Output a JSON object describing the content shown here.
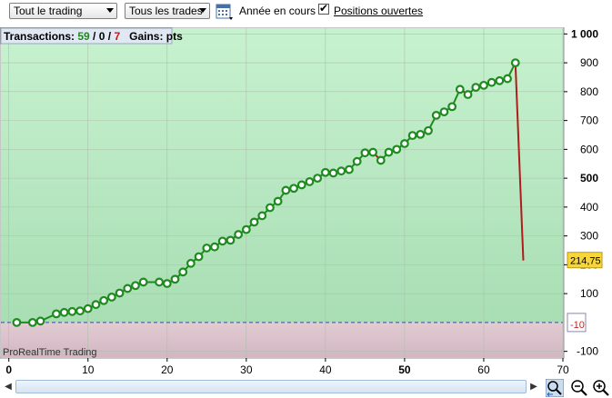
{
  "toolbar": {
    "scope_select": "Tout le trading",
    "trades_select": "Tous les trades",
    "period_label": "Année en cours",
    "open_positions_label": "Positions ouvertes",
    "open_positions_checked": true
  },
  "summary": {
    "prefix": "Transactions: ",
    "winning": "59",
    "sep1": " / ",
    "neutral": "0",
    "sep2": " / ",
    "losing": "7",
    "gains": "Gains: pts"
  },
  "watermark": "ProRealTime Trading",
  "last_value_badge": "214,75",
  "zero_badge": "-10",
  "colors": {
    "positive_zone": "#c3efcb",
    "negative_zone": "#dcc7d0",
    "gain_line": "#1f8a1f",
    "loss_line": "#b01c1c",
    "badge_yellow": "#f6d63b"
  },
  "chart_data": {
    "type": "line",
    "title": "",
    "xlabel": "",
    "ylabel": "",
    "xlim": [
      -1,
      70
    ],
    "ylim": [
      -120,
      1020
    ],
    "x_ticks": [
      "0",
      "10",
      "20",
      "30",
      "40",
      "50",
      "60",
      "70"
    ],
    "y_ticks": [
      "1 000",
      "900",
      "800",
      "700",
      "600",
      "500",
      "400",
      "300",
      "200",
      "100",
      "-100"
    ],
    "series": [
      {
        "values": [
          [
            1,
            0
          ],
          [
            3,
            0
          ],
          [
            4,
            5
          ],
          [
            6,
            30
          ],
          [
            7,
            35
          ],
          [
            8,
            38
          ],
          [
            9,
            40
          ],
          [
            10,
            48
          ],
          [
            11,
            62
          ],
          [
            12,
            76
          ],
          [
            13,
            88
          ],
          [
            14,
            102
          ],
          [
            15,
            118
          ],
          [
            16,
            128
          ],
          [
            17,
            140
          ],
          [
            19,
            140
          ],
          [
            20,
            135
          ],
          [
            21,
            150
          ],
          [
            22,
            175
          ],
          [
            23,
            205
          ],
          [
            24,
            228
          ],
          [
            25,
            258
          ],
          [
            26,
            262
          ],
          [
            27,
            282
          ],
          [
            28,
            285
          ],
          [
            29,
            305
          ],
          [
            30,
            322
          ],
          [
            31,
            348
          ],
          [
            32,
            370
          ],
          [
            33,
            398
          ],
          [
            34,
            420
          ],
          [
            35,
            458
          ],
          [
            36,
            465
          ],
          [
            37,
            477
          ],
          [
            38,
            488
          ],
          [
            39,
            500
          ],
          [
            40,
            520
          ],
          [
            41,
            518
          ],
          [
            42,
            525
          ],
          [
            43,
            530
          ],
          [
            44,
            558
          ],
          [
            45,
            588
          ],
          [
            46,
            590
          ],
          [
            47,
            562
          ],
          [
            48,
            590
          ],
          [
            49,
            600
          ],
          [
            50,
            620
          ],
          [
            51,
            648
          ],
          [
            52,
            652
          ],
          [
            53,
            665
          ],
          [
            54,
            718
          ],
          [
            55,
            730
          ],
          [
            56,
            748
          ],
          [
            57,
            808
          ],
          [
            58,
            790
          ],
          [
            59,
            815
          ],
          [
            60,
            822
          ],
          [
            61,
            832
          ],
          [
            62,
            838
          ],
          [
            63,
            845
          ],
          [
            64,
            900
          ],
          [
            65,
            214.75
          ]
        ]
      }
    ]
  }
}
